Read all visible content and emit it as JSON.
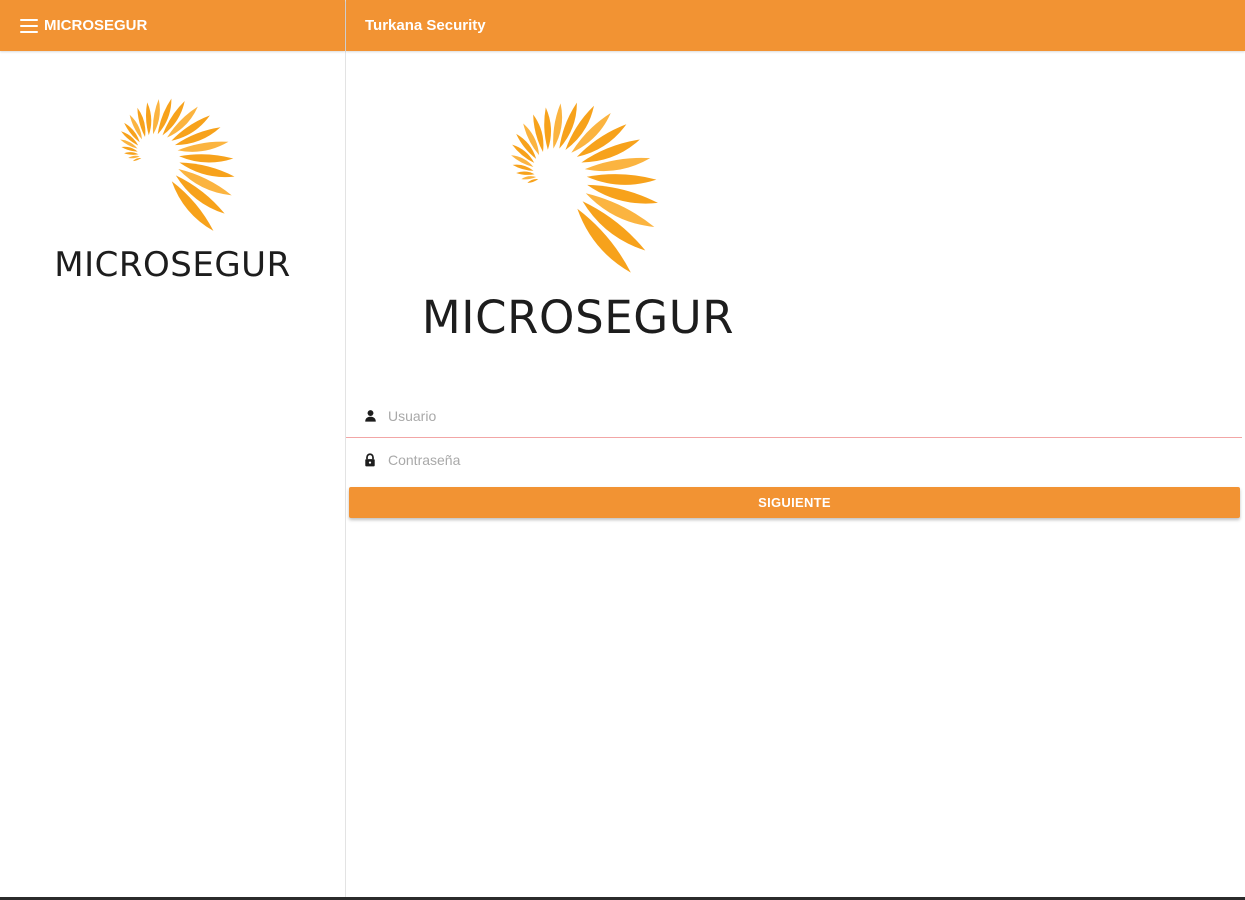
{
  "sidebar": {
    "title": "MICROSEGUR",
    "menu_icon": "hamburger-menu-icon",
    "logo_text": "MICROSEGUR"
  },
  "header": {
    "title": "Turkana Security"
  },
  "main": {
    "logo_text": "MICROSEGUR"
  },
  "login_form": {
    "username": {
      "icon": "user-icon",
      "placeholder": "Usuario",
      "value": ""
    },
    "password": {
      "icon": "lock-icon",
      "placeholder": "Contraseña",
      "value": ""
    },
    "submit_label": "SIGUIENTE"
  },
  "colors": {
    "accent": "#f29333",
    "logo_orange": "#f7a21b",
    "logo_light": "#fbb440",
    "input_underline": "#f2a6a6",
    "text_dark": "#1d1d1d"
  }
}
